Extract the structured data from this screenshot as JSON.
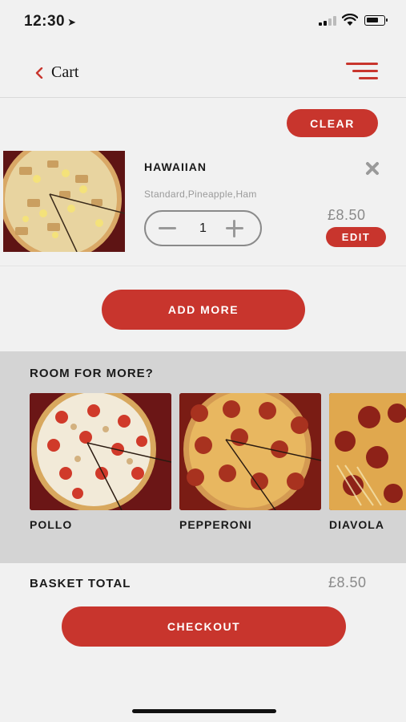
{
  "status_bar": {
    "time": "12:30",
    "location_icon": "location-arrow-icon",
    "signal_icon": "cellular-signal-icon",
    "wifi_icon": "wifi-icon",
    "battery_icon": "battery-icon"
  },
  "header": {
    "back_icon": "chevron-left-icon",
    "title": "Cart",
    "menu_icon": "menu-icon"
  },
  "clear_label": "CLEAR",
  "cart_item": {
    "name": "HAWAIIAN",
    "details": "Standard,Pineapple,Ham",
    "quantity": "1",
    "price": "£8.50",
    "edit_label": "EDIT",
    "remove_icon": "close-icon"
  },
  "add_more_label": "ADD MORE",
  "recommendations": {
    "title": "ROOM FOR MORE?",
    "items": [
      {
        "name": "POLLO"
      },
      {
        "name": "PEPPERONI"
      },
      {
        "name": "DIAVOLA"
      }
    ]
  },
  "basket": {
    "label": "BASKET TOTAL",
    "total": "£8.50"
  },
  "checkout_label": "CHECKOUT",
  "colors": {
    "accent": "#c8352d",
    "background": "#f1f1f1",
    "rec_background": "#d4d4d4",
    "muted_text": "#8a8a8a"
  }
}
